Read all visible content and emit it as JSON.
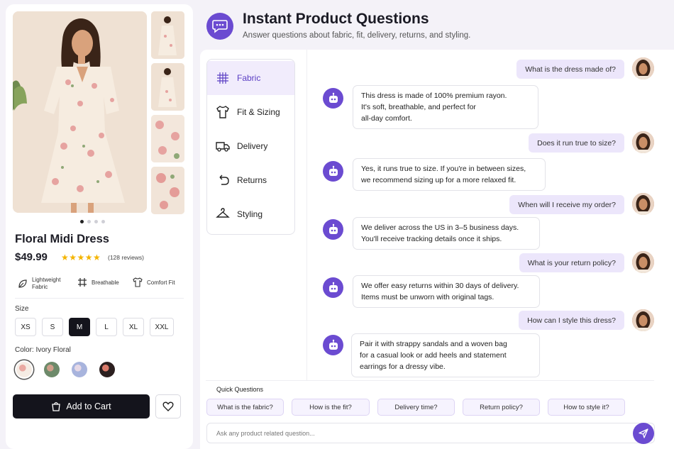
{
  "product": {
    "title": "Floral Midi Dress",
    "price": "$49.99",
    "rating": 5,
    "reviews": "(128 reviews)",
    "features": [
      {
        "label": "Lightweight Fabric",
        "icon": "leaf-icon"
      },
      {
        "label": "Breathable",
        "icon": "fabric-grid-icon"
      },
      {
        "label": "Comfort Fit",
        "icon": "tshirt-icon"
      }
    ],
    "size_label": "Size",
    "sizes": [
      "XS",
      "S",
      "M",
      "L",
      "XL",
      "XXL"
    ],
    "selected_size": "M",
    "color_label": "Color: Ivory Floral",
    "colors": [
      "#ecd7cf",
      "#6d8a6a",
      "#a8b4dd",
      "#2b1f1f"
    ],
    "add_to_cart": "Add to Cart",
    "image_dots": 4,
    "active_dot": 0
  },
  "header": {
    "title": "Instant Product Questions",
    "subtitle": "Answer questions about fabric, fit, delivery, returns, and styling."
  },
  "menu": [
    {
      "label": "Fabric",
      "icon": "fabric-grid-icon",
      "active": true
    },
    {
      "label": "Fit & Sizing",
      "icon": "tshirt-icon",
      "active": false
    },
    {
      "label": "Delivery",
      "icon": "truck-icon",
      "active": false
    },
    {
      "label": "Returns",
      "icon": "return-arrow-icon",
      "active": false
    },
    {
      "label": "Styling",
      "icon": "hanger-icon",
      "active": false
    }
  ],
  "chat": [
    {
      "q": "What is the dress made of?",
      "a": [
        "This dress is made of 100% premium rayon.",
        "It's soft, breathable, and perfect for",
        "all-day comfort."
      ]
    },
    {
      "q": "Does it run true to size?",
      "a": [
        "Yes, it runs true to size. If you're in between sizes,",
        "we recommend sizing up for a more relaxed fit."
      ]
    },
    {
      "q": "When will I receive my order?",
      "a": [
        "We deliver across the US in 3–5 business days.",
        "You'll receive tracking details once it ships."
      ]
    },
    {
      "q": "What is your return policy?",
      "a": [
        "We offer easy returns within 30 days of delivery.",
        "Items must be unworn with original tags."
      ]
    },
    {
      "q": "How can I style this dress?",
      "a": [
        "Pair it with strappy sandals and a woven bag",
        "for a casual look or add heels and statement",
        "earrings for a dressy vibe."
      ]
    }
  ],
  "quick": {
    "label": "Quick Questions",
    "chips": [
      "What is the fabric?",
      "How is the fit?",
      "Delivery time?",
      "Return policy?",
      "How to style it?"
    ]
  },
  "input": {
    "placeholder": "Ask any product related question..."
  },
  "colors": {
    "accent": "#6b4bd1",
    "accent_light": "#ece6fb",
    "dark": "#14141c"
  }
}
